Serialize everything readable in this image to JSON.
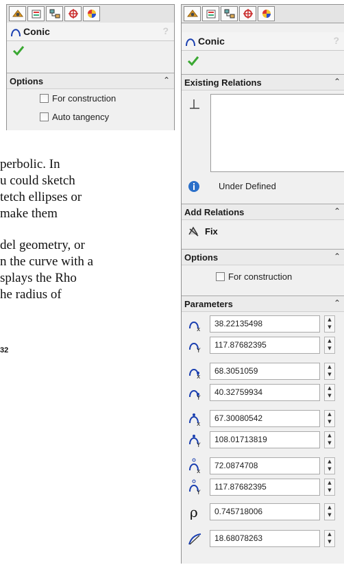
{
  "left_panel": {
    "tabs": [
      "feature-manager-icon",
      "property-manager-icon",
      "configuration-manager-icon",
      "dimxpert-icon",
      "appearance-icon"
    ],
    "title": "Conic",
    "help": "?",
    "options": {
      "header": "Options",
      "checkboxes": [
        {
          "label": "For construction",
          "checked": false
        },
        {
          "label": "Auto tangency",
          "checked": false
        }
      ]
    }
  },
  "document": {
    "lines": [
      "perbolic. In",
      "u could sketch",
      "tetch ellipses or",
      "make them",
      "del geometry, or",
      "n the curve with a",
      "splays the Rho",
      "he radius of"
    ],
    "page_number": "32"
  },
  "right_panel": {
    "tabs": [
      "feature-manager-icon",
      "property-manager-icon",
      "configuration-manager-icon",
      "dimxpert-icon",
      "appearance-icon"
    ],
    "title": "Conic",
    "help": "?",
    "existing_relations": {
      "header": "Existing Relations",
      "status": "Under Defined"
    },
    "add_relations": {
      "header": "Add Relations",
      "items": [
        "Fix"
      ]
    },
    "options": {
      "header": "Options",
      "checkboxes": [
        {
          "label": "For construction",
          "checked": false
        }
      ]
    },
    "parameters": {
      "header": "Parameters",
      "values": [
        {
          "icon": "start-x-icon",
          "value": "38.22135498"
        },
        {
          "icon": "start-y-icon",
          "value": "117.87682395"
        },
        {
          "icon": "end-x-icon",
          "value": "68.3051059"
        },
        {
          "icon": "end-y-icon",
          "value": "40.32759934"
        },
        {
          "icon": "top-vertex-x-icon",
          "value": "67.30080542"
        },
        {
          "icon": "top-vertex-y-icon",
          "value": "108.01713819"
        },
        {
          "icon": "conic-point-x-icon",
          "value": "72.0874708"
        },
        {
          "icon": "conic-point-y-icon",
          "value": "117.87682395"
        },
        {
          "icon": "rho-icon",
          "value": "0.745718006"
        },
        {
          "icon": "radius-of-curvature-icon",
          "value": "18.68078263"
        }
      ]
    }
  },
  "colors": {
    "panel_bg": "#f0f0f0",
    "ok_green": "#3aa832",
    "info_blue": "#2a6fc9"
  }
}
